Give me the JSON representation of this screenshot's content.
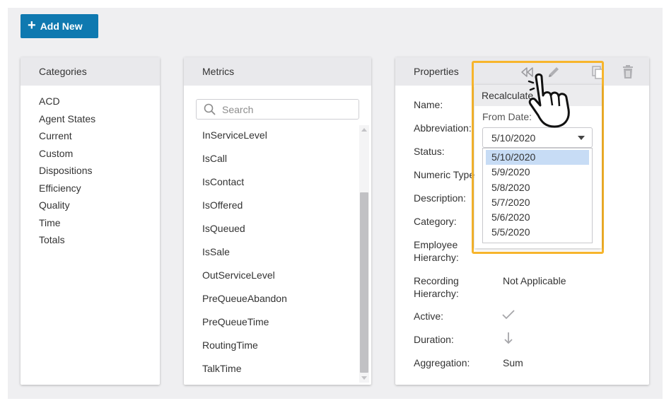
{
  "toolbar": {
    "add_new_label": "Add New"
  },
  "categories": {
    "title": "Categories",
    "items": [
      "ACD",
      "Agent States",
      "Current",
      "Custom",
      "Dispositions",
      "Efficiency",
      "Quality",
      "Time",
      "Totals"
    ]
  },
  "metrics": {
    "title": "Metrics",
    "search_placeholder": "Search",
    "items": [
      "InServiceLevel",
      "IsCall",
      "IsContact",
      "IsOffered",
      "IsQueued",
      "IsSale",
      "OutServiceLevel",
      "PreQueueAbandon",
      "PreQueueTime",
      "RoutingTime",
      "TalkTime"
    ]
  },
  "properties": {
    "title": "Properties",
    "labels": {
      "name": "Name:",
      "abbreviation": "Abbreviation:",
      "status": "Status:",
      "numeric_type": "Numeric Type:",
      "description": "Description:",
      "category": "Category:",
      "employee_hierarchy": [
        "Employee",
        "Hierarchy:"
      ],
      "recording_hierarchy": [
        "Recording",
        "Hierarchy:"
      ],
      "active": "Active:",
      "duration": "Duration:",
      "aggregation": "Aggregation:"
    },
    "values": {
      "recording_hierarchy": "Not Applicable",
      "aggregation": "Sum"
    },
    "icons": [
      "rewind-icon",
      "pencil-icon",
      "copy-icon",
      "trash-icon"
    ]
  },
  "recalculate_popover": {
    "title": "Recalculate",
    "from_date_label": "From Date:",
    "selected": "5/10/2020",
    "options": [
      "5/10/2020",
      "5/9/2020",
      "5/8/2020",
      "5/7/2020",
      "5/6/2020",
      "5/5/2020"
    ]
  },
  "colors": {
    "primary": "#0f79b0",
    "highlight": "#f7b52c",
    "selected_option": "#c7dcf5",
    "panel_header": "#e9e9ec"
  }
}
